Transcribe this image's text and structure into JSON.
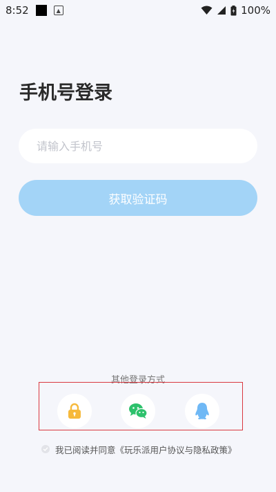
{
  "status_bar": {
    "time": "8:52",
    "battery": "100%"
  },
  "page": {
    "title": "手机号登录"
  },
  "phone_input": {
    "placeholder": "请输入手机号",
    "value": ""
  },
  "get_code_button": {
    "label": "获取验证码"
  },
  "other_login": {
    "label": "其他登录方式",
    "methods": [
      {
        "icon": "lock-icon",
        "color": "#f6b93b"
      },
      {
        "icon": "wechat-icon",
        "color": "#2dc16c"
      },
      {
        "icon": "qq-icon",
        "color": "#6fb8f5"
      }
    ]
  },
  "agreement": {
    "text": "我已阅读并同意《玩乐派用户协议与隐私政策》"
  },
  "colors": {
    "background": "#f5f6fb",
    "button": "#a3d4f7",
    "highlight_border": "#d9363e"
  }
}
